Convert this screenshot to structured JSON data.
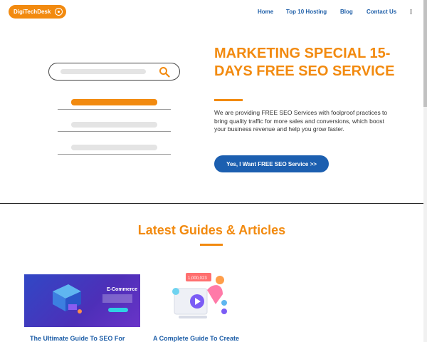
{
  "brand": {
    "logo_text": "DigiTechDesk"
  },
  "nav": {
    "items": [
      "Home",
      "Top 10 Hosting",
      "Blog",
      "Contact Us"
    ]
  },
  "hero": {
    "title": "MARKETING SPECIAL 15-DAYS FREE SEO SERVICE",
    "body": "We are providing FREE SEO Services with foolproof practices to bring quality traffic for more sales and conversions, which boost your business revenue and help you grow faster.",
    "cta_label": "Yes, I Want FREE SEO Service >>"
  },
  "articles": {
    "section_title": "Latest Guides & Articles",
    "items": [
      {
        "title": "The Ultimate Guide To SEO For",
        "thumb_heading": "E-Commerce"
      },
      {
        "title": "A Complete Guide To Create",
        "thumb_badge": "1,000,023"
      }
    ]
  },
  "colors": {
    "accent": "#f28a0f",
    "link": "#1f5fa8",
    "cta": "#1c5fb0"
  }
}
